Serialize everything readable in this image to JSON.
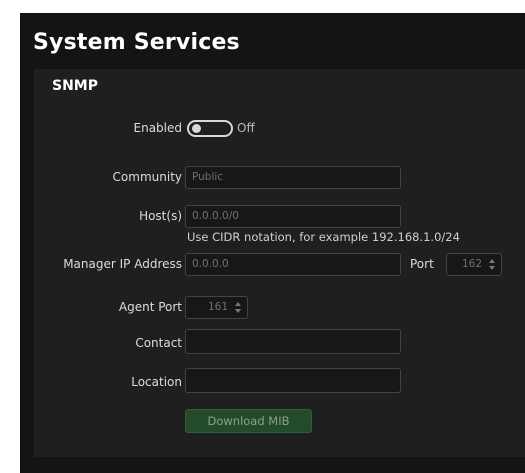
{
  "page": {
    "title": "System Services"
  },
  "snmp": {
    "section_title": "SNMP",
    "enabled": {
      "label": "Enabled",
      "state_text": "Off",
      "on": false
    },
    "community": {
      "label": "Community",
      "placeholder": "Public",
      "value": ""
    },
    "hosts": {
      "label": "Host(s)",
      "placeholder": "0.0.0.0/0",
      "value": "",
      "hint": "Use CIDR notation, for example 192.168.1.0/24"
    },
    "manager_ip": {
      "label": "Manager IP Address",
      "placeholder": "0.0.0.0",
      "value": ""
    },
    "port": {
      "label": "Port",
      "value": "162"
    },
    "agent_port": {
      "label": "Agent Port",
      "value": "161"
    },
    "contact": {
      "label": "Contact",
      "value": ""
    },
    "location": {
      "label": "Location",
      "value": ""
    },
    "download_mib": {
      "label": "Download MIB",
      "disabled": true
    }
  },
  "colors": {
    "background": "#141414",
    "panel": "#1f1f1f",
    "input_border": "#444444",
    "button_green": "#234a2b"
  }
}
